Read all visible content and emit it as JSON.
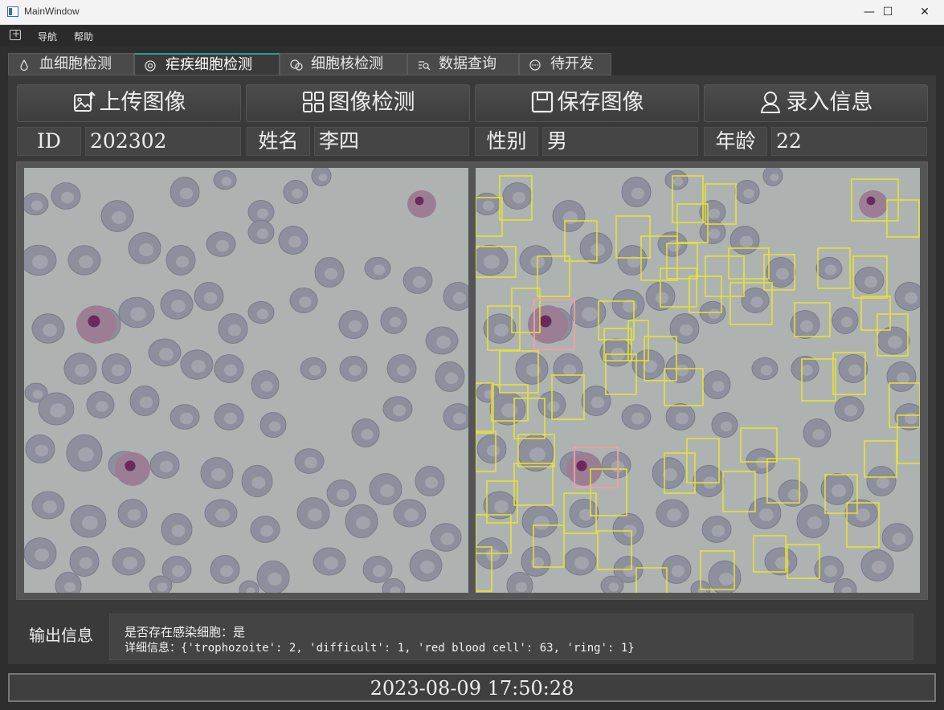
{
  "window": {
    "title": "MainWindow",
    "minimize_glyph": "—",
    "maximize_glyph": "☐",
    "close_glyph": "✕"
  },
  "menubar": {
    "items": [
      "导航",
      "帮助"
    ]
  },
  "tabs": [
    {
      "label": "血细胞检测",
      "icon": "drop-icon",
      "active": false
    },
    {
      "label": "疟疾细胞检测",
      "icon": "target-icon",
      "active": true
    },
    {
      "label": "细胞核检测",
      "icon": "cells-icon",
      "active": false
    },
    {
      "label": "数据查询",
      "icon": "search-list-icon",
      "active": false
    },
    {
      "label": "待开发",
      "icon": "more-icon",
      "active": false
    }
  ],
  "toolbar": {
    "upload_label": "上传图像",
    "detect_label": "图像检测",
    "save_label": "保存图像",
    "register_label": "录入信息"
  },
  "patient": {
    "id_label": "ID",
    "id_value": "202302",
    "name_label": "姓名",
    "name_value": "李四",
    "gender_label": "性别",
    "gender_value": "男",
    "age_label": "年龄",
    "age_value": "22"
  },
  "output": {
    "label": "输出信息",
    "line1": "是否存在感染细胞：是",
    "line2": "详细信息：{'trophozoite': 2, 'difficult': 1, 'red blood cell': 63, 'ring': 1}"
  },
  "status": {
    "datetime": "2023-08-09  17:50:28"
  },
  "colors": {
    "accent": "#23a58d",
    "rbc_box": "#e6e62e",
    "infected_box": "#f0a0a0",
    "cell_fill": "#8e8f9c",
    "background_smear": "#aeb3b2"
  }
}
